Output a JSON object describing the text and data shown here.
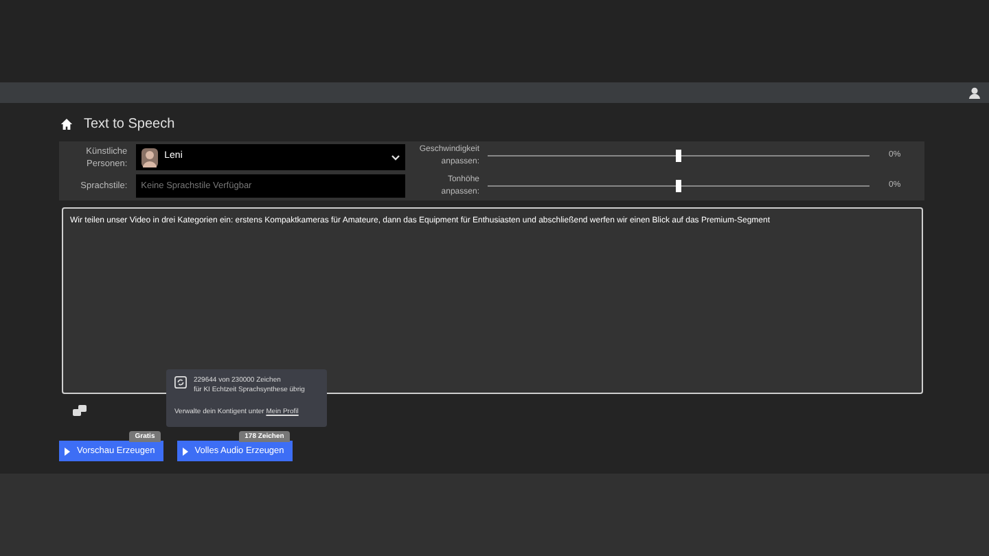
{
  "page": {
    "title": "Text to Speech"
  },
  "voice": {
    "label": "Künstliche Personen:",
    "value": "Leni"
  },
  "style": {
    "label": "Sprachstile:",
    "placeholder": "Keine Sprachstile Verfügbar"
  },
  "sliders": [
    {
      "label": "Geschwindigkeit anpassen:",
      "level": 0.5,
      "reading": "0%"
    },
    {
      "label": "Tonhöhe anpassen:",
      "level": 0.5,
      "reading": "0%"
    }
  ],
  "text_input": {
    "value": "Wir teilen unser Video in drei Kategorien ein: erstens Kompaktkameras für Amateure, dann das Equipment für Enthusiasten und abschließend werfen wir einen Blick auf das Premium-Segment"
  },
  "quota_tooltip": {
    "line_1": "229644 von 230000 Zeichen",
    "line_2": "für KI Echtzeit Sprachsynthese übrig",
    "note": "Verwalte dein Kontigent unter",
    "link": "Mein Profil"
  },
  "buttons": [
    {
      "label": "Vorschau Erzeugen",
      "badge": "Gratis"
    },
    {
      "label": "Volles Audio Erzeugen",
      "badge": "178 Zeichen"
    }
  ]
}
